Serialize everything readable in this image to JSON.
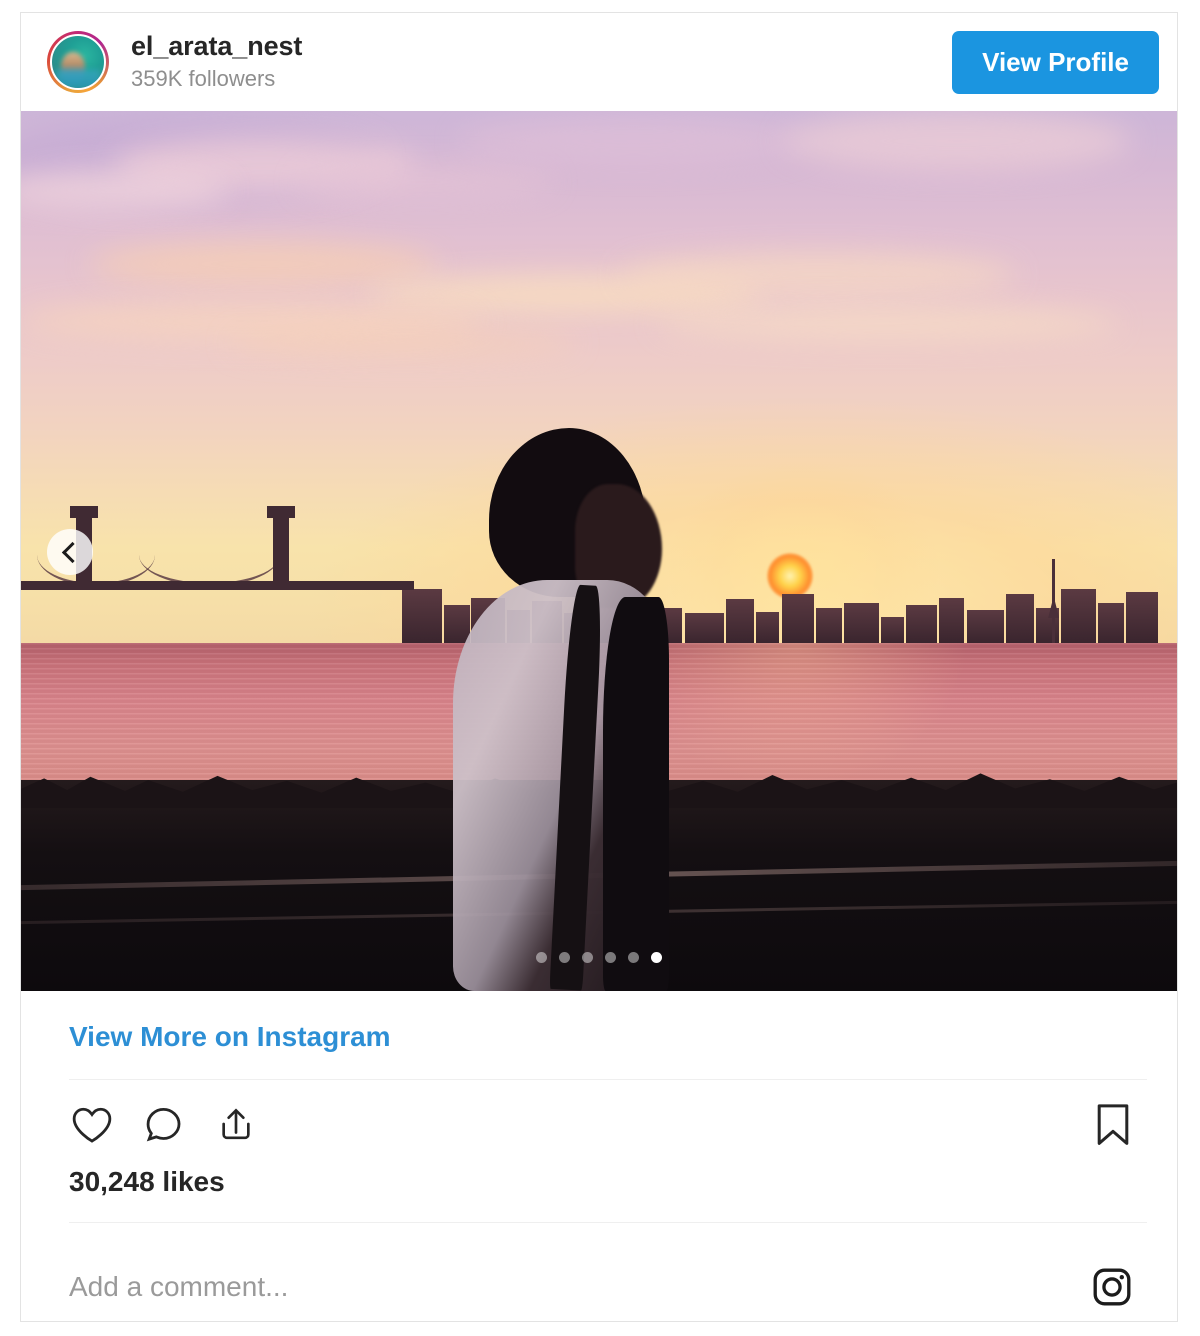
{
  "header": {
    "account_name": "el_arata_nest",
    "followers": "359K followers",
    "view_profile_label": "View Profile",
    "avatar_name": "profile-avatar",
    "button_color": "#1b95e0"
  },
  "media": {
    "prev_icon": "chevron-left-icon",
    "carousel": {
      "total": 6,
      "active_index": 5
    },
    "scene": {
      "description": "Sunset over Tokyo Bay with person silhouette",
      "sky_top_color": "#cdb6d8",
      "sky_bottom_color": "#f3d8a4",
      "water_color": "#d9838a",
      "foreground_color": "#0d0a0d"
    }
  },
  "footer": {
    "view_more_label": "View More on Instagram",
    "view_more_color": "#2d8fd5",
    "like_icon": "heart-icon",
    "comment_icon": "comment-bubble-icon",
    "share_icon": "share-arrow-icon",
    "bookmark_icon": "bookmark-icon",
    "likes_count": "30,248 likes",
    "comment_placeholder": "Add a comment...",
    "instagram_icon": "instagram-logo-icon"
  }
}
